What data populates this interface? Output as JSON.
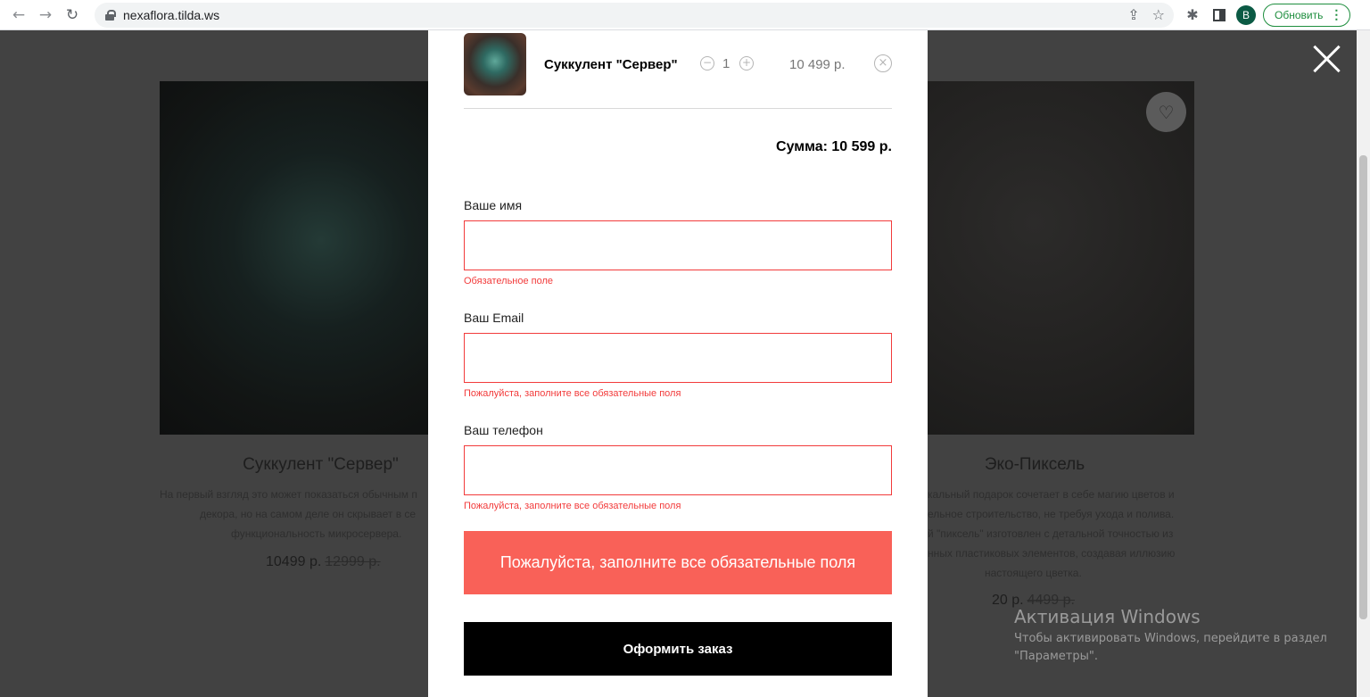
{
  "browser": {
    "url": "nexaflora.tilda.ws",
    "avatar_letter": "B",
    "update_label": "Обновить",
    "icons": [
      "back-arrow-icon",
      "forward-arrow-icon",
      "reload-icon",
      "lock-icon",
      "share-icon",
      "star-icon",
      "extensions-icon",
      "side-panel-icon",
      "more-icon"
    ]
  },
  "background_page": {
    "left_card": {
      "title": "Суккулент \"Сервер\"",
      "description": "На первый взгляд это может показаться обычным п... декора, но на самом деле он скрывает в се... функциональность микросервера.",
      "desc_line1": "На первый взгляд это может показаться обычным п",
      "desc_line2": "декора, но на самом деле он скрывает в се",
      "desc_line3": "функциональность микросервера.",
      "price": "10499 р.",
      "old_price": "12999 р."
    },
    "right_card": {
      "title": "Эко-Пиксель",
      "desc_line1": "кальный подарок сочетает в себе магию цветов и",
      "desc_line2": "ельное строительство, не требуя ухода и полива.",
      "desc_line3": "й \"пиксель\" изготовлен с детальной точностью из",
      "desc_line4": "нных пластиковых элементов, создавая иллюзию",
      "desc_line5": "настоящего цветка.",
      "price": "20 р.",
      "old_price": "4499 р."
    }
  },
  "cart": {
    "item": {
      "name": "Суккулент \"Сервер\"",
      "quantity": "1",
      "price": "10 499 р."
    },
    "total": "Сумма: 10 599 р.",
    "fields": [
      {
        "label": "Ваше имя",
        "error": "Обязательное поле",
        "value": ""
      },
      {
        "label": "Ваш Email",
        "error": "Пожалуйста, заполните все обязательные поля",
        "value": ""
      },
      {
        "label": "Ваш телефон",
        "error": "Пожалуйста, заполните все обязательные поля",
        "value": ""
      }
    ],
    "error_banner": "Пожалуйста, заполните все обязательные поля",
    "submit_label": "Оформить заказ"
  },
  "watermark": {
    "title": "Активация Windows",
    "line1": "Чтобы активировать Windows, перейдите в раздел",
    "line2": "\"Параметры\"."
  },
  "colors": {
    "error": "#f23b3b",
    "banner": "#f96158",
    "submit": "#000000",
    "update_green": "#1e8e3e"
  }
}
